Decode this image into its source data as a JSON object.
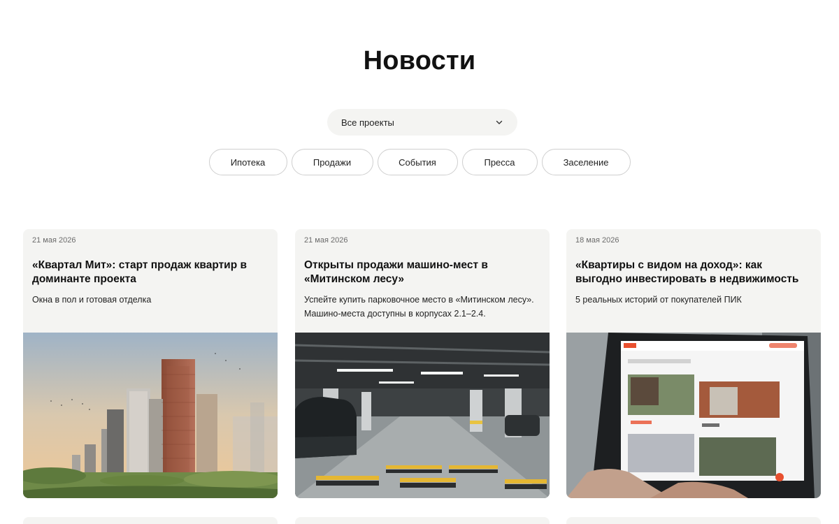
{
  "page": {
    "title": "Новости"
  },
  "filter": {
    "selected": "Все проекты"
  },
  "categories": [
    "Ипотека",
    "Продажи",
    "События",
    "Пресса",
    "Заселение"
  ],
  "cards": [
    {
      "date": "21 мая 2026",
      "title": "«Квартал Мит»: старт продаж квартир в доминанте проекта",
      "description": "Окна в пол и готовая отделка",
      "image": "building-exterior-image"
    },
    {
      "date": "21 мая 2026",
      "title": " Открыты продажи машино-мест в «Митинском лесу»",
      "description": "Успейте купить парковочное место в «Митинском лесу». Машино-места доступны в корпусах 2.1–2.4.",
      "image": "underground-parking-image"
    },
    {
      "date": "18 мая 2026",
      "title": "«Квартиры с видом на доход»: как выгодно инвестировать в недвижимость",
      "description": "5 реальных историй от покупателей ПИК",
      "image": "laptop-listings-image"
    }
  ],
  "colors": {
    "card_bg": "#f4f4f2",
    "chip_border": "#cfcfcf",
    "accent": "#e8502f"
  }
}
